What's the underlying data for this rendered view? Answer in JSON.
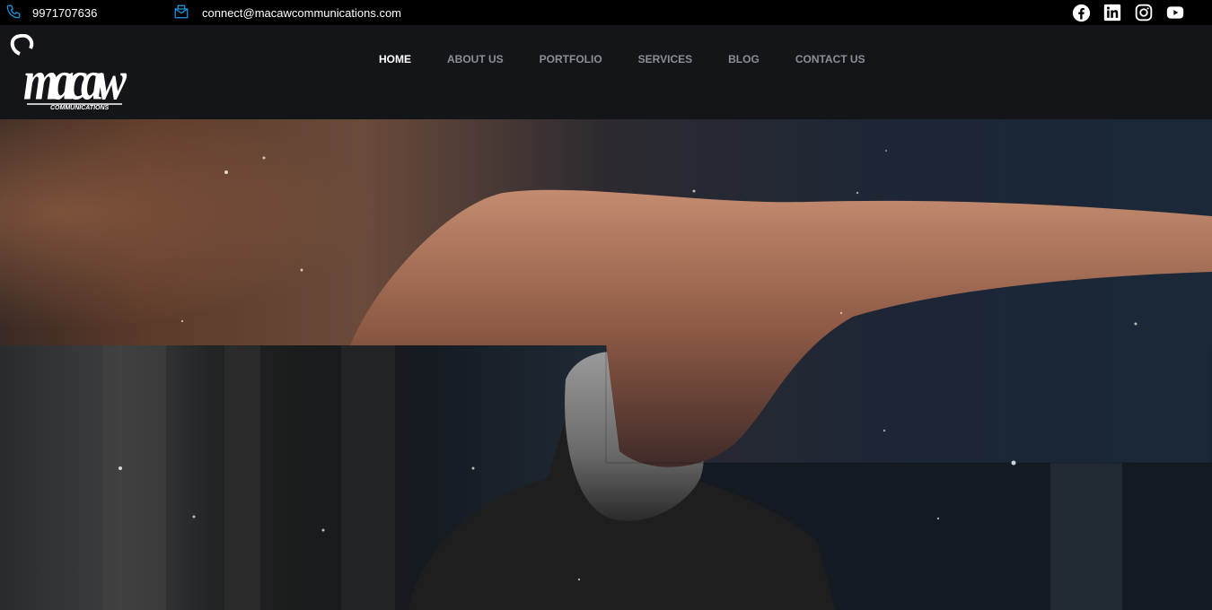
{
  "topbar": {
    "phone": "9971707636",
    "email": "connect@macawcommunications.com",
    "phone_icon": "phone-icon",
    "email_icon": "email-icon",
    "social_icons": [
      "facebook-icon",
      "linkedin-icon",
      "instagram-icon",
      "youtube-icon"
    ]
  },
  "brand": {
    "logo_text": "macaw",
    "logo_subtext": "COMMUNICATIONS"
  },
  "nav": {
    "items": [
      {
        "label": "HOME",
        "active": true
      },
      {
        "label": "ABOUT US",
        "active": false
      },
      {
        "label": "PORTFOLIO",
        "active": false
      },
      {
        "label": "SERVICES",
        "active": false
      },
      {
        "label": "BLOG",
        "active": false
      },
      {
        "label": "CONTACT US",
        "active": false
      }
    ]
  },
  "colors": {
    "accent": "#1a9be8",
    "topbar_bg": "#000000",
    "header_bg": "#141518",
    "nav_inactive": "#8b8e93"
  }
}
